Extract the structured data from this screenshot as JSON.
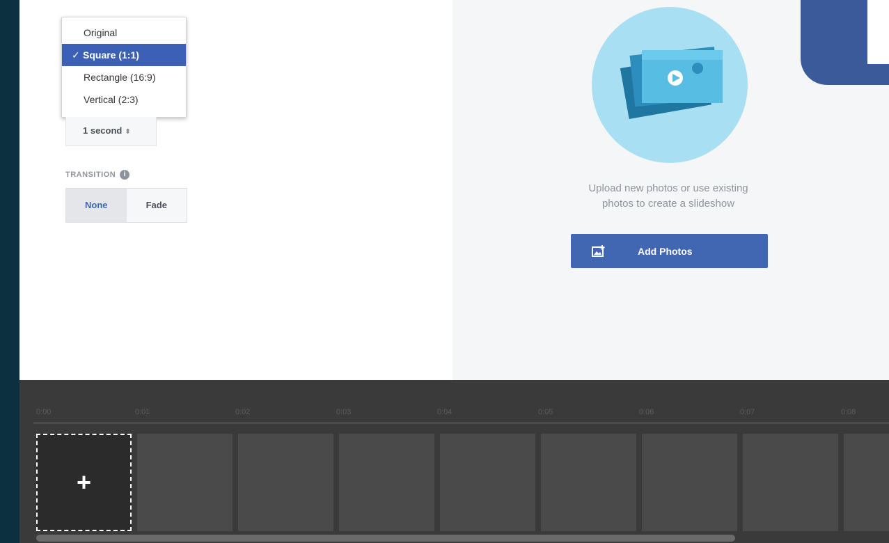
{
  "aspect_menu": {
    "items": [
      {
        "label": "Original",
        "selected": false
      },
      {
        "label": "Square (1:1)",
        "selected": true
      },
      {
        "label": "Rectangle (16:9)",
        "selected": false
      },
      {
        "label": "Vertical (2:3)",
        "selected": false
      }
    ],
    "check_glyph": "✓"
  },
  "duration": {
    "value": "1 second",
    "arrow_glyph": "⬍"
  },
  "transition": {
    "label": "TRANSITION",
    "info_glyph": "i",
    "options": [
      {
        "label": "None",
        "active": true
      },
      {
        "label": "Fade",
        "active": false
      }
    ]
  },
  "upload": {
    "line1": "Upload new photos or use existing",
    "line2": "photos to create a slideshow",
    "button_label": "Add Photos",
    "button_icon": "add-photo-icon",
    "illustration_icon": "photo-stack-play-icon"
  },
  "timeline": {
    "ticks": [
      "0:00",
      "0:01",
      "0:02",
      "0:03",
      "0:04",
      "0:05",
      "0:06",
      "0:07",
      "0:08"
    ],
    "add_glyph": "+",
    "slot_count": 9
  },
  "colors": {
    "accent": "#4267b2",
    "selected_menu": "#3b60b5",
    "timeline_bg": "#3a3a3a",
    "page_bg": "#0d3040"
  }
}
